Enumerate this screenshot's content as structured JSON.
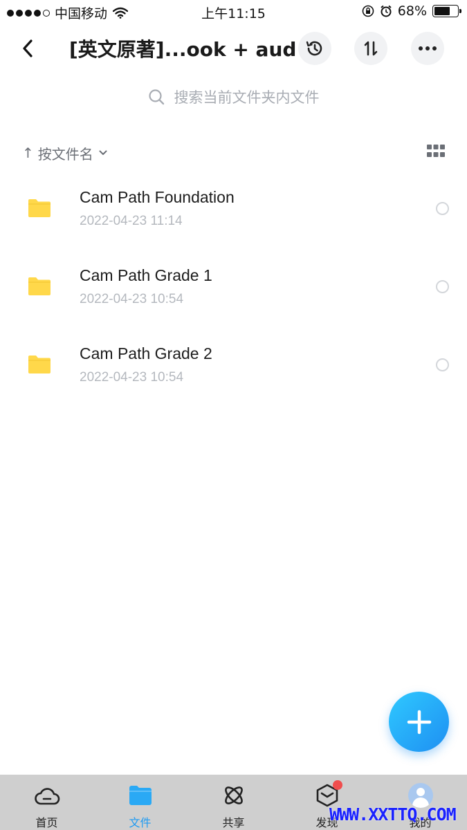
{
  "status_bar": {
    "carrier": "中国移动",
    "time": "上午11:15",
    "battery_percent": "68%",
    "battery_level": 0.68,
    "icons": [
      "signal-dots",
      "wifi-icon",
      "rotation-lock-icon",
      "alarm-icon",
      "battery-icon"
    ]
  },
  "navbar": {
    "title": "[英文原著]...ook +   audio",
    "icons": [
      "back-chevron-icon",
      "history-icon",
      "sort-arrows-icon",
      "more-dots-icon"
    ]
  },
  "search": {
    "placeholder": "搜索当前文件夹内文件"
  },
  "sort": {
    "arrow": "↑",
    "label": "按文件名",
    "icons": [
      "chevron-down-icon",
      "grid-view-icon"
    ]
  },
  "files": [
    {
      "name": "Cam Path Foundation",
      "date": "2022-04-23 11:14"
    },
    {
      "name": "Cam Path Grade 1",
      "date": "2022-04-23 10:54"
    },
    {
      "name": "Cam Path Grade 2",
      "date": "2022-04-23 10:54"
    }
  ],
  "tabs": [
    {
      "label": "首页",
      "icon": "cloud-icon",
      "active": false
    },
    {
      "label": "文件",
      "icon": "folder-icon",
      "active": true
    },
    {
      "label": "共享",
      "icon": "atom-icon",
      "active": false
    },
    {
      "label": "发现",
      "icon": "cube-icon",
      "active": false,
      "badge": true
    },
    {
      "label": "我的",
      "icon": "avatar-icon",
      "active": false
    }
  ],
  "colors": {
    "accent": "#1d9af2",
    "folder": "#ffd84a",
    "badge": "#f04e4e"
  },
  "watermark": "WWW.XXTTQ.COM"
}
